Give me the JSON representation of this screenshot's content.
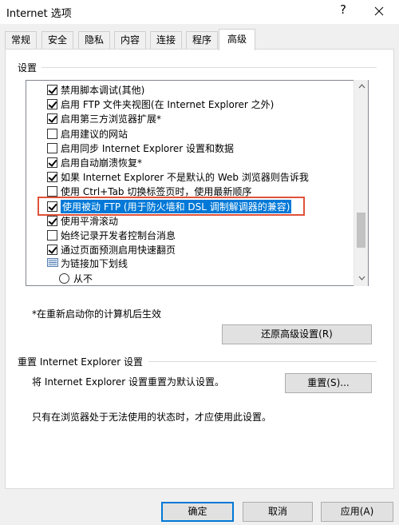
{
  "window": {
    "title": "Internet 选项",
    "help_glyph": "?",
    "close_glyph": "✕"
  },
  "tabs": [
    {
      "label": "常规"
    },
    {
      "label": "安全"
    },
    {
      "label": "隐私"
    },
    {
      "label": "内容"
    },
    {
      "label": "连接"
    },
    {
      "label": "程序"
    },
    {
      "label": "高级"
    }
  ],
  "active_tab": "高级",
  "settings": {
    "group_label": "设置",
    "items": [
      {
        "label": "禁用脚本调试(其他)",
        "checked": true
      },
      {
        "label": "启用 FTP 文件夹视图(在 Internet Explorer 之外)",
        "checked": true
      },
      {
        "label": "启用第三方浏览器扩展*",
        "checked": true
      },
      {
        "label": "启用建议的网站",
        "checked": false
      },
      {
        "label": "启用同步 Internet Explorer 设置和数据",
        "checked": false
      },
      {
        "label": "启用自动崩溃恢复*",
        "checked": true
      },
      {
        "label": "如果 Internet Explorer 不是默认的 Web 浏览器则告诉我",
        "checked": true
      },
      {
        "label": "使用 Ctrl+Tab 切换标签页时，使用最新顺序",
        "checked": false
      },
      {
        "label": "使用被动 FTP (用于防火墙和 DSL 调制解调器的兼容)",
        "checked": true
      },
      {
        "label": "使用平滑滚动",
        "checked": true
      },
      {
        "label": "始终记录开发者控制台消息",
        "checked": false
      },
      {
        "label": "通过页面预测启用快速翻页",
        "checked": true
      }
    ],
    "folder_item": "为链接加下划线",
    "radio_item": "从不",
    "restart_note": "*在重新启动你的计算机后生效",
    "restore_button": "还原高级设置(R)"
  },
  "reset": {
    "group_label": "重置 Internet Explorer 设置",
    "description": "将 Internet Explorer 设置重置为默认设置。",
    "button": "重置(S)...",
    "warning": "只有在浏览器处于无法使用的状态时，才应使用此设置。"
  },
  "footer": {
    "ok": "确定",
    "cancel": "取消",
    "apply": "应用(A)"
  },
  "colors": {
    "highlight": "#0078d7",
    "annotation_box": "#e0523a"
  }
}
